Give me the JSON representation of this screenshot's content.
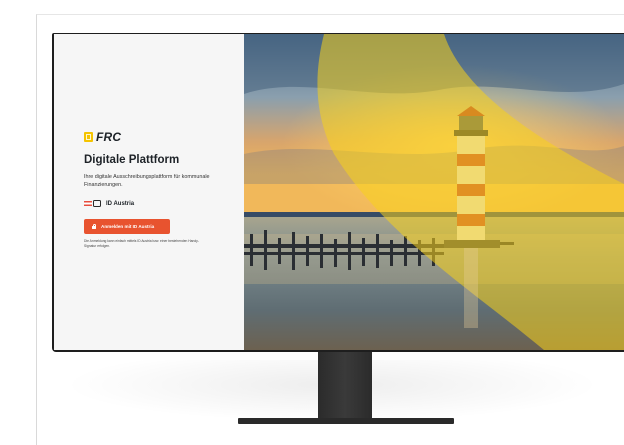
{
  "login": {
    "logo_text": "FRC",
    "title": "Digitale Plattform",
    "subtitle": "Ihre digitale Ausschreibungsplattform für kommunale Finanzierungen.",
    "id_label": "ID Austria",
    "button_label": "Anmelden mit ID Austria",
    "note": "Die Anmeldung kann einfach mittels ID Austria bzw. einer bestehenden Handy-Signatur erfolgen."
  },
  "colors": {
    "accent": "#e8532f",
    "logo": "#f5c400",
    "overlay": "#f7d21a"
  },
  "icons": {
    "logo": "frc-logo-icon",
    "flag": "austria-flag-icon",
    "id": "id-card-icon",
    "lock": "lock-icon"
  }
}
